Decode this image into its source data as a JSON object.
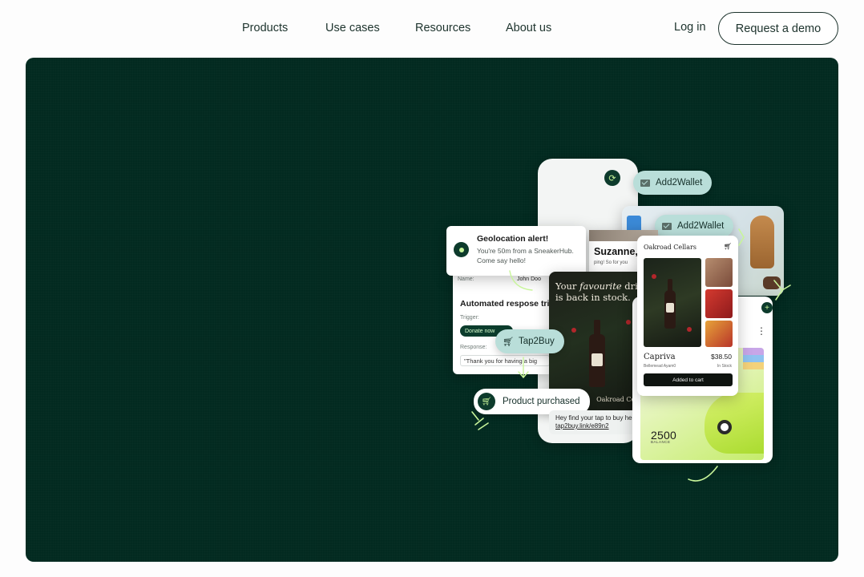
{
  "nav": {
    "links": [
      "Products",
      "Use cases",
      "Resources",
      "About us"
    ],
    "login": "Log in",
    "cta": "Request a demo"
  },
  "collage": {
    "add2wallet_primary": "Add2Wallet",
    "add2wallet_secondary": "Add2Wallet",
    "geo": {
      "title": "Geolocation alert!",
      "text": "You're 50m from a SneakerHub. Come say hello!"
    },
    "profile": {
      "greeting": "Suzanne,",
      "sub": "ping! So for you"
    },
    "form": {
      "name_label": "Name:",
      "name_value": "John Doo",
      "title": "Automated respose tri",
      "trigger_label": "Trigger:",
      "trigger_value": "Donate now",
      "response_label": "Response:",
      "response_value": "\"Thank you for having a big"
    },
    "tap2buy": "Tap2Buy",
    "product_purchased": "Product purchased",
    "wine": {
      "headline_1": "Your ",
      "headline_em": "favourite",
      "headline_2": " drink",
      "headline_3": "is back in stock.",
      "brand": "Oakroad Cellars"
    },
    "shop": {
      "brand": "Oakroad Cellars",
      "product": "Capriva",
      "price": "$38.50",
      "sub": "Bellemead Ayam0",
      "stock": "In Stock",
      "button": "Added to cart"
    },
    "sms": {
      "text": "Hey find your tap to buy here.",
      "link": "tap2buy.link/e89n2"
    },
    "loyalty": {
      "balance": "2500",
      "label": "BALANCE"
    },
    "icons": {
      "cart": "cart-icon",
      "mail": "mail-icon",
      "pin": "location-pin-icon",
      "sync": "sync-icon"
    }
  },
  "colors": {
    "hero_bg": "#022a20",
    "accent_lime": "#c8f59a",
    "pill_mint": "#b9ded9",
    "text_dark": "#16302a"
  }
}
